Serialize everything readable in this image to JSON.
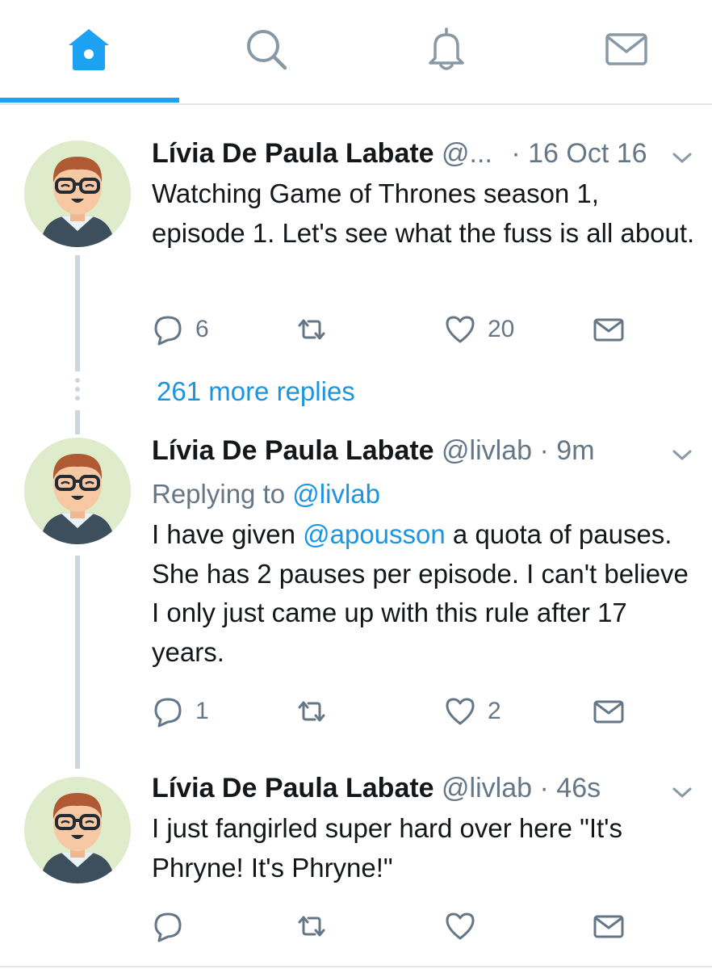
{
  "nav": {
    "tabs": [
      {
        "name": "home",
        "icon": "home-icon",
        "active": true
      },
      {
        "name": "search",
        "icon": "search-icon",
        "active": false
      },
      {
        "name": "notifications",
        "icon": "bell-icon",
        "active": false
      },
      {
        "name": "messages",
        "icon": "mail-icon",
        "active": false
      }
    ],
    "accent_color": "#1da1f2"
  },
  "tweets": [
    {
      "name": "Lívia De Paula Labate",
      "handle": "@...",
      "sep": "·",
      "time": "16 Oct 16",
      "text": "Watching Game of Thrones season 1, episode 1. Let's see what the fuss is all about.",
      "reply_count": "6",
      "like_count": "20"
    },
    {
      "name": "Lívia De Paula Labate",
      "handle": "@livlab",
      "sep": "·",
      "time": "9m",
      "replying_label": "Replying to",
      "replying_handle": "@livlab",
      "text_before": "I have given ",
      "text_mention": "@apousson",
      "text_after": " a quota of pauses. She has 2 pauses per episode. I can't believe I only just came up with this rule after 17 years.",
      "reply_count": "1",
      "like_count": "2"
    },
    {
      "name": "Lívia De Paula Labate",
      "handle": "@livlab",
      "sep": "·",
      "time": "46s",
      "text": "I just fangirled super hard over here \"It's Phryne! It's Phryne!\"",
      "reply_count": "",
      "like_count": ""
    }
  ],
  "more_replies": "261 more replies",
  "colors": {
    "link": "#1b95e0",
    "muted": "#657786",
    "thread_line": "#ccd6dd"
  }
}
